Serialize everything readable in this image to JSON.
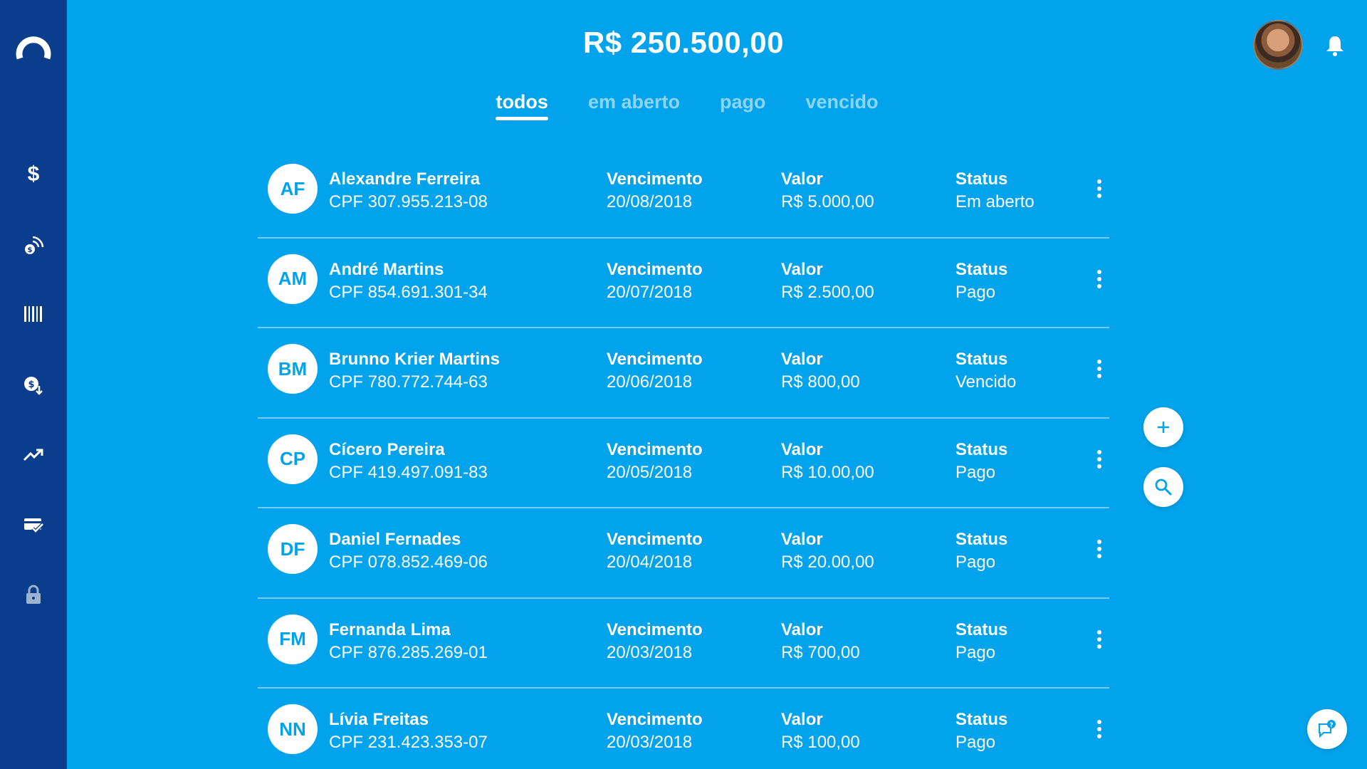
{
  "header": {
    "balance": "R$ 250.500,00"
  },
  "tabs": [
    {
      "label": "todos",
      "active": true
    },
    {
      "label": "em aberto",
      "active": false
    },
    {
      "label": "pago",
      "active": false
    },
    {
      "label": "vencido",
      "active": false
    }
  ],
  "sidebar": {
    "items": [
      {
        "icon": "dollar-icon",
        "glyph": "$"
      },
      {
        "icon": "payment-signal-icon"
      },
      {
        "icon": "barcode-icon"
      },
      {
        "icon": "withdraw-money-icon"
      },
      {
        "icon": "trending-chart-icon"
      },
      {
        "icon": "card-check-icon"
      },
      {
        "icon": "lock-icon"
      }
    ]
  },
  "labels": {
    "due": "Vencimento",
    "amount": "Valor",
    "status": "Status"
  },
  "colors": {
    "background": "#01a3ed",
    "sidebar": "#0a3d8c",
    "text": "#ffffff"
  },
  "rows": [
    {
      "initials": "AF",
      "name": "Alexandre Ferreira",
      "cpf": "CPF 307.955.213-08",
      "due": "20/08/2018",
      "amount": "R$ 5.000,00",
      "status": "Em aberto"
    },
    {
      "initials": "AM",
      "name": "André Martins",
      "cpf": "CPF 854.691.301-34",
      "due": "20/07/2018",
      "amount": "R$ 2.500,00",
      "status": "Pago"
    },
    {
      "initials": "BM",
      "name": "Brunno Krier Martins",
      "cpf": "CPF 780.772.744-63",
      "due": "20/06/2018",
      "amount": "R$ 800,00",
      "status": "Vencido"
    },
    {
      "initials": "CP",
      "name": "Cícero Pereira",
      "cpf": "CPF 419.497.091-83",
      "due": "20/05/2018",
      "amount": "R$ 10.00,00",
      "status": "Pago"
    },
    {
      "initials": "DF",
      "name": "Daniel Fernades",
      "cpf": "CPF 078.852.469-06",
      "due": "20/04/2018",
      "amount": "R$ 20.00,00",
      "status": "Pago"
    },
    {
      "initials": "FM",
      "name": "Fernanda Lima",
      "cpf": "CPF 876.285.269-01",
      "due": "20/03/2018",
      "amount": "R$ 700,00",
      "status": "Pago"
    },
    {
      "initials": "NN",
      "name": "Lívia Freitas",
      "cpf": "CPF 231.423.353-07",
      "due": "20/03/2018",
      "amount": "R$ 100,00",
      "status": "Pago"
    }
  ]
}
